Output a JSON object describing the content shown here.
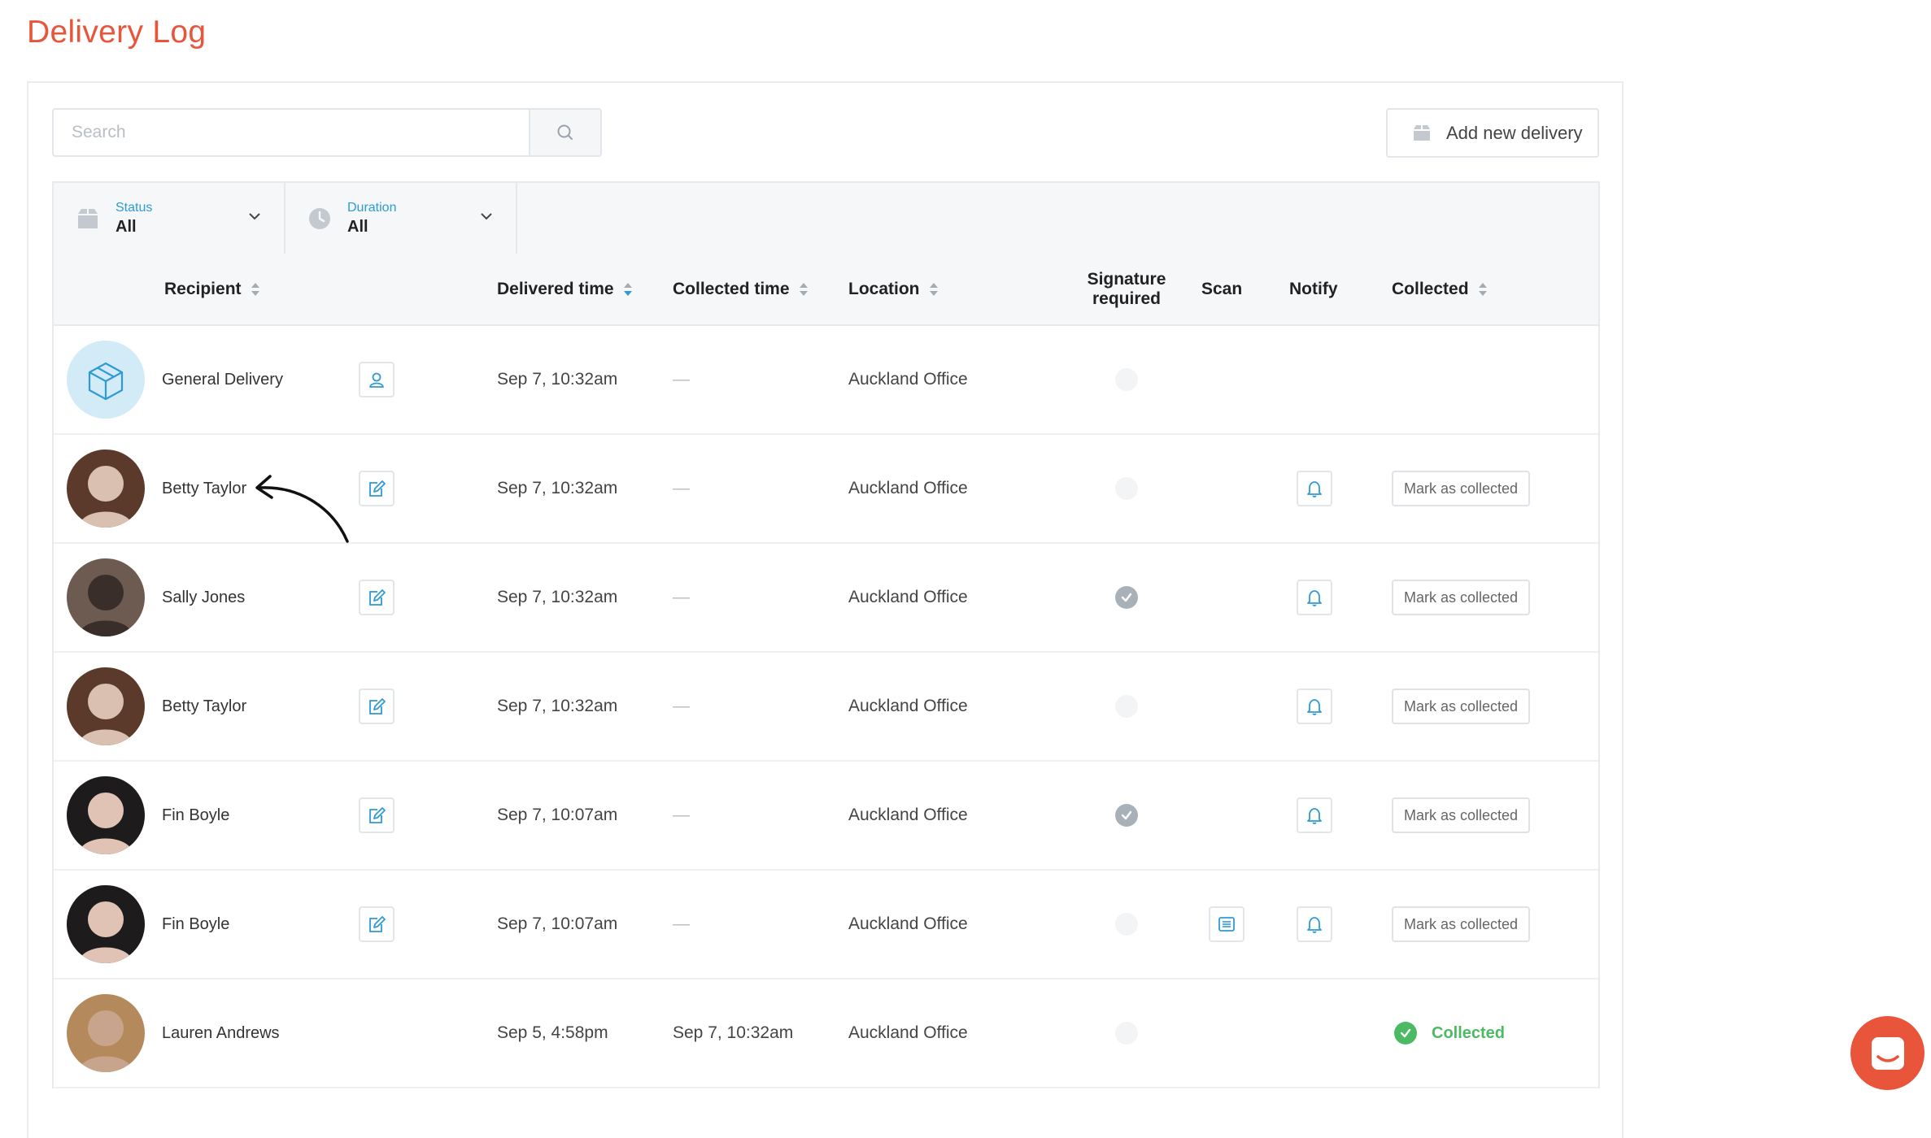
{
  "page": {
    "title": "Delivery Log"
  },
  "search": {
    "placeholder": "Search",
    "value": ""
  },
  "actions": {
    "add_delivery_label": "Add new delivery"
  },
  "filters": [
    {
      "caption": "Status",
      "value": "All",
      "icon": "package-icon"
    },
    {
      "caption": "Duration",
      "value": "All",
      "icon": "clock-icon"
    }
  ],
  "columns": {
    "recipient": "Recipient",
    "delivered": "Delivered time",
    "collected_time": "Collected time",
    "location": "Location",
    "signature_line1": "Signature",
    "signature_line2": "required",
    "scan": "Scan",
    "notify": "Notify",
    "collected": "Collected"
  },
  "rows": [
    {
      "name": "General Delivery",
      "avatar": "package-avatar",
      "action_icon": "user-icon",
      "delivered": "Sep 7, 10:32am",
      "collected_time": "—",
      "location": "Auckland Office",
      "signature_required": false,
      "scan": false,
      "notify": false,
      "collected": null
    },
    {
      "name": "Betty Taylor",
      "avatar": "photo",
      "action_icon": "edit-icon",
      "delivered": "Sep 7, 10:32am",
      "collected_time": "—",
      "location": "Auckland Office",
      "signature_required": false,
      "scan": false,
      "notify": true,
      "collected": false
    },
    {
      "name": "Sally Jones",
      "avatar": "photo",
      "action_icon": "edit-icon",
      "delivered": "Sep 7, 10:32am",
      "collected_time": "—",
      "location": "Auckland Office",
      "signature_required": true,
      "scan": false,
      "notify": true,
      "collected": false
    },
    {
      "name": "Betty Taylor",
      "avatar": "photo",
      "action_icon": "edit-icon",
      "delivered": "Sep 7, 10:32am",
      "collected_time": "—",
      "location": "Auckland Office",
      "signature_required": false,
      "scan": false,
      "notify": true,
      "collected": false
    },
    {
      "name": "Fin Boyle",
      "avatar": "photo",
      "action_icon": "edit-icon",
      "delivered": "Sep 7, 10:07am",
      "collected_time": "—",
      "location": "Auckland Office",
      "signature_required": true,
      "scan": false,
      "notify": true,
      "collected": false
    },
    {
      "name": "Fin Boyle",
      "avatar": "photo",
      "action_icon": "edit-icon",
      "delivered": "Sep 7, 10:07am",
      "collected_time": "—",
      "location": "Auckland Office",
      "signature_required": false,
      "scan": true,
      "notify": true,
      "collected": false
    },
    {
      "name": "Lauren Andrews",
      "avatar": "photo",
      "action_icon": null,
      "delivered": "Sep 5, 4:58pm",
      "collected_time": "Sep 7, 10:32am",
      "location": "Auckland Office",
      "signature_required": false,
      "scan": false,
      "notify": false,
      "collected": true
    }
  ],
  "labels": {
    "mark_collected": "Mark as collected",
    "collected": "Collected"
  },
  "colors": {
    "accent": "#e8553a",
    "link": "#2e9ad6",
    "success": "#4cb963"
  }
}
